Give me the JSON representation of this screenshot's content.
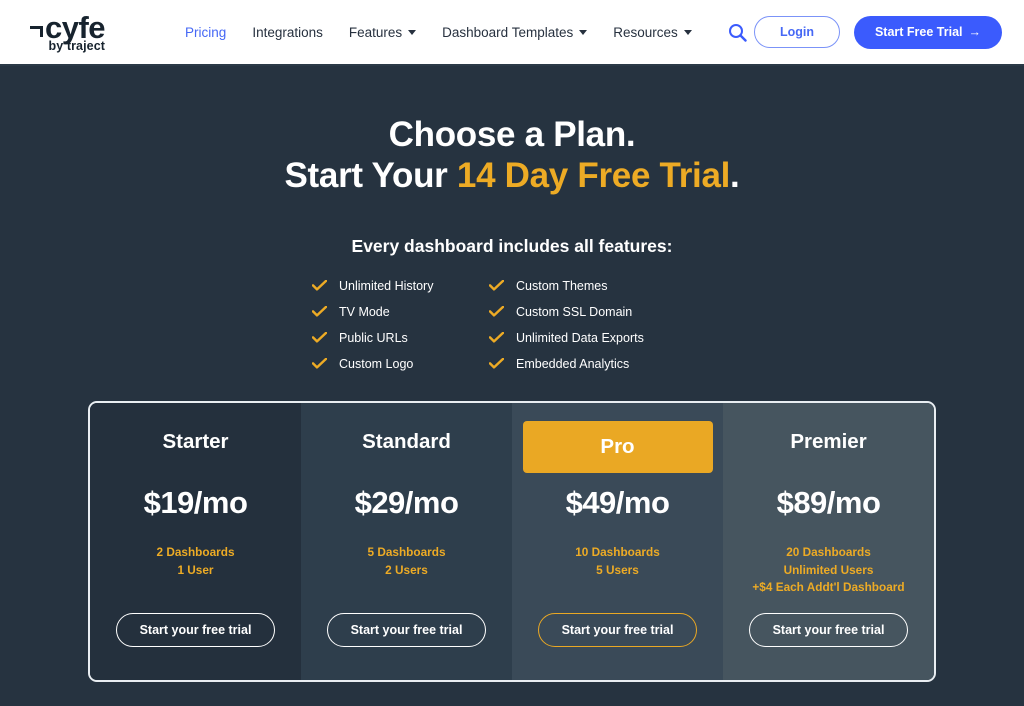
{
  "header": {
    "logo": {
      "main": "cyfe",
      "sub": "by traject",
      "corner_icon": "logo-corner-mark"
    },
    "nav": [
      {
        "label": "Pricing",
        "active": true,
        "caret": false
      },
      {
        "label": "Integrations",
        "active": false,
        "caret": false
      },
      {
        "label": "Features",
        "active": false,
        "caret": true
      },
      {
        "label": "Dashboard Templates",
        "active": false,
        "caret": true
      },
      {
        "label": "Resources",
        "active": false,
        "caret": true
      }
    ],
    "search_icon": "search-icon",
    "login_label": "Login",
    "trial_label": "Start Free Trial",
    "trial_arrow": "→",
    "accent_blue": "#3b5bfd",
    "logo_color": "#17232e"
  },
  "hero": {
    "line1": "Choose a Plan.",
    "line2_prefix": "Start Your ",
    "line2_highlight": "14 Day Free Trial",
    "line2_suffix": ".",
    "subhead": "Every dashboard includes all features:",
    "gold": "#edab25",
    "background": "#263340"
  },
  "features": {
    "column_left": [
      "Unlimited History",
      "TV Mode",
      "Public URLs",
      "Custom Logo"
    ],
    "column_right": [
      "Custom Themes",
      "Custom SSL Domain",
      "Unlimited Data Exports",
      "Embedded Analytics"
    ],
    "check_icon": "check-icon",
    "check_color": "#edab25"
  },
  "pricing": {
    "border_color": "#e9eef2",
    "plans": [
      {
        "name": "Starter",
        "price": "$19/mo",
        "specs": [
          "2 Dashboards",
          "1 User"
        ],
        "cta": "Start your free trial",
        "featured": false,
        "bg": "#24303d"
      },
      {
        "name": "Standard",
        "price": "$29/mo",
        "specs": [
          "5 Dashboards",
          "2 Users"
        ],
        "cta": "Start your free trial",
        "featured": false,
        "bg": "#2e3e4c"
      },
      {
        "name": "Pro",
        "price": "$49/mo",
        "specs": [
          "10 Dashboards",
          "5 Users"
        ],
        "cta": "Start your free trial",
        "featured": true,
        "bg": "#3a4a58",
        "header_bg": "#eaa824"
      },
      {
        "name": "Premier",
        "price": "$89/mo",
        "specs": [
          "20 Dashboards",
          "Unlimited Users",
          "+$4 Each Addt'l Dashboard"
        ],
        "cta": "Start your free trial",
        "featured": false,
        "bg": "#46555f"
      }
    ]
  }
}
